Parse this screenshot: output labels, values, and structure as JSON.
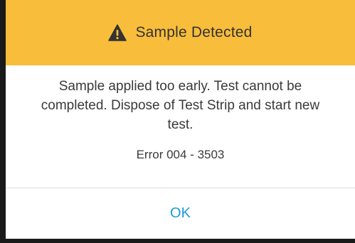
{
  "dialog": {
    "title": "Sample Detected",
    "title_icon": "warning-triangle-icon",
    "message": "Sample applied too early. Test cannot be completed. Dispose of Test Strip and start new test.",
    "error_code": "Error 004 - 3503",
    "ok_label": "OK"
  },
  "colors": {
    "header_bg": "#f8bd3a",
    "button_text": "#1d9bd6",
    "body_text": "#3a3a3a"
  }
}
